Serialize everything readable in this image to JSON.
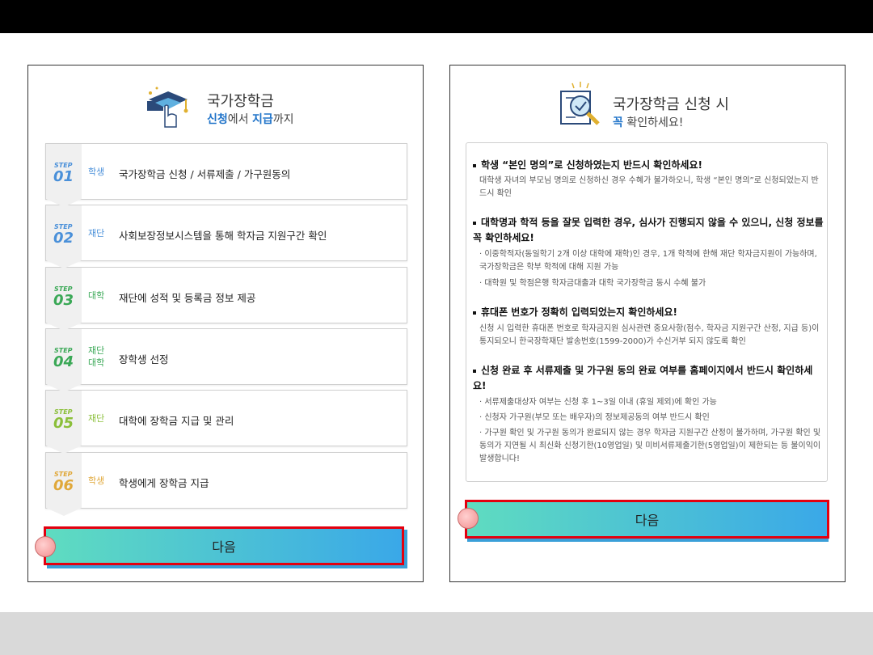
{
  "left_panel": {
    "title": "국가장학금",
    "subtitle_part1": "신청",
    "subtitle_part2": "에서 ",
    "subtitle_part3": "지급",
    "subtitle_part4": "까지",
    "steps": [
      {
        "word": "STEP",
        "num": "01",
        "actor": "학생",
        "actor2": "",
        "desc": "국가장학금 신청 / 서류제출 / 가구원동의",
        "color": "#4a90d9"
      },
      {
        "word": "STEP",
        "num": "02",
        "actor": "재단",
        "actor2": "",
        "desc": "사회보장정보시스템을 통해 학자금 지원구간 확인",
        "color": "#4a90d9"
      },
      {
        "word": "STEP",
        "num": "03",
        "actor": "대학",
        "actor2": "",
        "desc": "재단에 성적 및 등록금 정보 제공",
        "color": "#3aa856"
      },
      {
        "word": "STEP",
        "num": "04",
        "actor": "재단",
        "actor2": "대학",
        "desc": "장학생 선정",
        "color": "#3aa856"
      },
      {
        "word": "STEP",
        "num": "05",
        "actor": "재단",
        "actor2": "",
        "desc": "대학에 장학금 지급 및 관리",
        "color": "#8bbf3a"
      },
      {
        "word": "STEP",
        "num": "06",
        "actor": "학생",
        "actor2": "",
        "desc": "학생에게 장학금 지급",
        "color": "#e0a83a"
      }
    ],
    "next_label": "다음"
  },
  "right_panel": {
    "title": "국가장학금 신청 시",
    "subtitle_part1": "꼭",
    "subtitle_part2": " 확인하세요!",
    "items": [
      {
        "heading": "학생 “본인 명의”로 신청하였는지 반드시 확인하세요!",
        "body": [
          "대학생 자녀의 부모님 명의로 신청하신 경우 수혜가 불가하오니, 학생 “본인 명의”로 신청되었는지 반드시 확인"
        ]
      },
      {
        "heading": "대학명과 학적 등을 잘못 입력한 경우, 심사가 진행되지 않을 수 있으니, 신청 정보를 꼭 확인하세요!",
        "body": [
          "· 이중학적자(동일학기 2개 이상 대학에 재학)인 경우, 1개 학적에 한해 재단 학자금지원이 가능하며, 국가장학금은 학부 학적에 대해 지원 가능",
          "· 대학원 및 학점은행 학자금대출과 대학 국가장학금 동시 수혜 불가"
        ]
      },
      {
        "heading": "휴대폰 번호가 정확히 입력되었는지 확인하세요!",
        "body": [
          "신청 시 입력한 휴대폰 번호로 학자금지원 심사관련 중요사항(점수, 학자금 지원구간 산정, 지급 등)이 통지되오니 한국장학재단 발송번호(1599-2000)가 수신거부 되지 않도록 확인"
        ]
      },
      {
        "heading": "신청 완료 후 서류제출 및 가구원 동의 완료 여부를 홈페이지에서 반드시 확인하세요!",
        "body": [
          "· 서류제출대상자 여부는 신청 후 1~3일 이내 (휴일 제외)에 확인 가능",
          "· 신청자 가구원(부모 또는 배우자)의 정보제공동의 여부 반드시 확인",
          "· 가구원 확인 및 가구원 동의가 완료되지 않는 경우 학자금 지원구간 산정이 불가하며, 가구원 확인 및 동의가 지연될 시 최신화 신청기한(10영업일) 및 미비서류제출기한(5영업일)이 제한되는 등 불이익이 발생합니다!"
        ]
      }
    ],
    "next_label": "다음"
  }
}
